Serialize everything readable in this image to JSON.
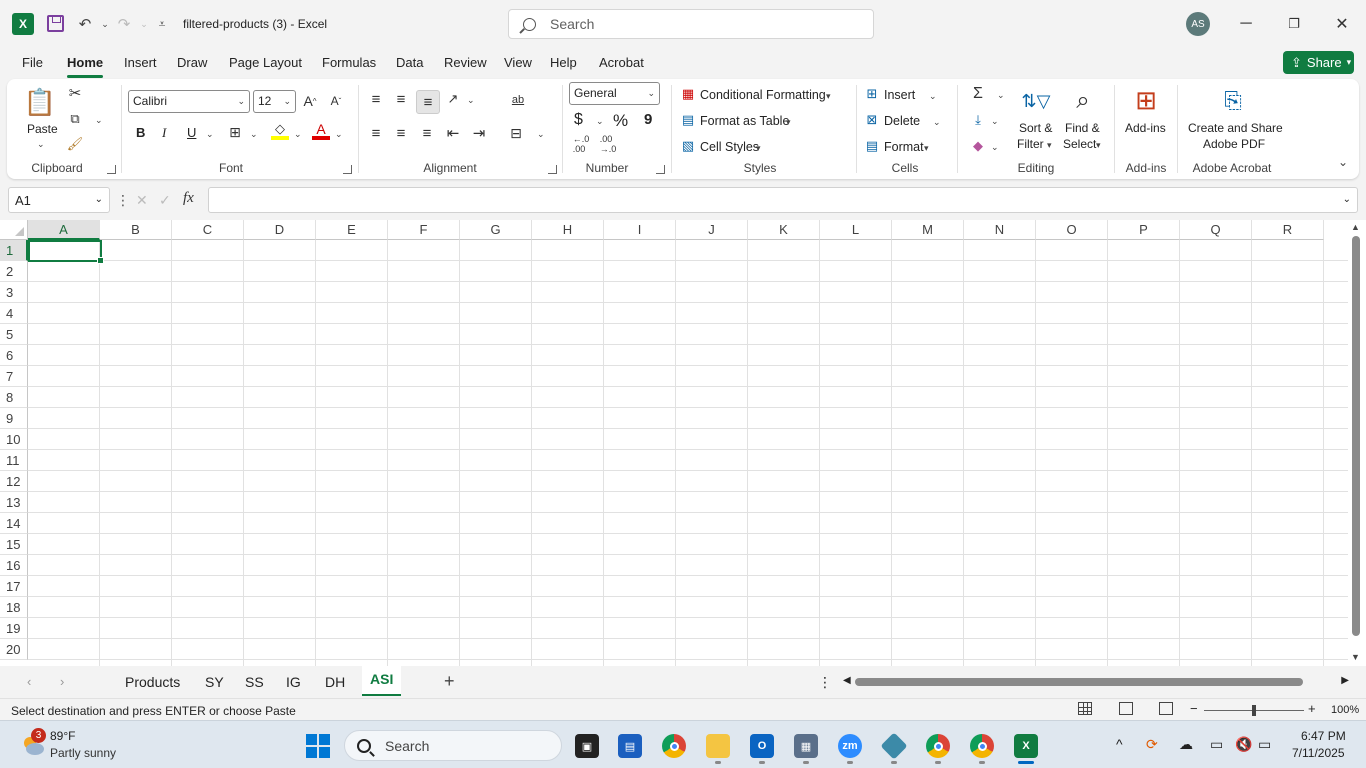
{
  "titlebar": {
    "app_icon_letter": "X",
    "doc_title": "filtered-products (3)  -  Excel",
    "search_placeholder": "Search",
    "avatar_initials": "AS"
  },
  "menu": {
    "tabs": [
      "File",
      "Home",
      "Insert",
      "Draw",
      "Page Layout",
      "Formulas",
      "Data",
      "Review",
      "View",
      "Help",
      "Acrobat"
    ],
    "active_tab": "Home",
    "share_label": "Share"
  },
  "ribbon": {
    "clipboard": {
      "paste_label": "Paste",
      "group_label": "Clipboard"
    },
    "font": {
      "font_name": "Calibri",
      "font_size": "12",
      "group_label": "Font",
      "bold": "B",
      "italic": "I",
      "underline": "U"
    },
    "alignment": {
      "group_label": "Alignment"
    },
    "number": {
      "format": "General",
      "group_label": "Number",
      "currency": "$",
      "percent": "%",
      "comma": "9"
    },
    "styles": {
      "conditional": "Conditional Formatting",
      "format_table": "Format as Table",
      "cell_styles": "Cell Styles",
      "group_label": "Styles"
    },
    "cells": {
      "insert": "Insert",
      "delete": "Delete",
      "format": "Format",
      "group_label": "Cells"
    },
    "editing": {
      "sort_filter_1": "Sort &",
      "sort_filter_2": "Filter",
      "find_select_1": "Find &",
      "find_select_2": "Select",
      "group_label": "Editing"
    },
    "addins": {
      "label": "Add-ins",
      "group_label": "Add-ins"
    },
    "acrobat": {
      "label_1": "Create and Share",
      "label_2": "Adobe PDF",
      "group_label": "Adobe Acrobat"
    }
  },
  "formula_bar": {
    "name_box": "A1",
    "fx": "fx",
    "formula": ""
  },
  "grid": {
    "columns": [
      "A",
      "B",
      "C",
      "D",
      "E",
      "F",
      "G",
      "H",
      "I",
      "J",
      "K",
      "L",
      "M",
      "N",
      "O",
      "P",
      "Q",
      "R"
    ],
    "rows": [
      "1",
      "2",
      "3",
      "4",
      "5",
      "6",
      "7",
      "8",
      "9",
      "10",
      "11",
      "12",
      "13",
      "14",
      "15",
      "16",
      "17",
      "18",
      "19",
      "20"
    ],
    "selected_cell": "A1"
  },
  "sheets": {
    "tabs": [
      "Products",
      "SY",
      "SS",
      "IG",
      "DH",
      "ASI"
    ],
    "active": "ASI",
    "add": "+"
  },
  "status": {
    "message": "Select destination and press ENTER or choose Paste",
    "zoom": "100%",
    "zoom_fraction": 0.5
  },
  "taskbar": {
    "weather_temp": "89°F",
    "weather_desc": "Partly sunny",
    "weather_badge": "3",
    "search_placeholder": "Search",
    "time": "6:47 PM",
    "date": "7/11/2025"
  },
  "colors": {
    "excel_green": "#107c41",
    "windows_blue": "#0078d4"
  }
}
